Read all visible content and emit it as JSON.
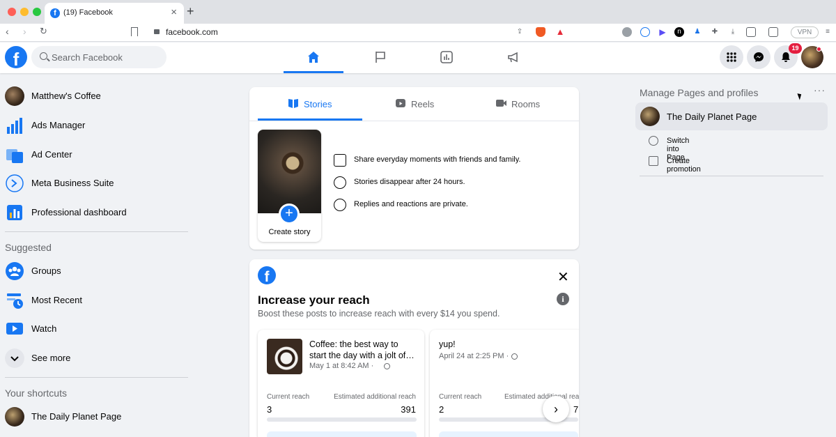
{
  "browser": {
    "tab_title": "(19) Facebook",
    "tab_close": "×",
    "new_tab": "+",
    "url": "facebook.com",
    "vpn_label": "VPN"
  },
  "header": {
    "logo": "f",
    "search_placeholder": "Search Facebook",
    "notifications_count": "19",
    "accent_color": "#1877f2",
    "nav_tabs": [
      "home-icon",
      "flag-icon",
      "chart-icon",
      "megaphone-icon"
    ]
  },
  "sidebar": {
    "items": [
      {
        "label": "Matthew's Coffee"
      },
      {
        "label": "Ads Manager"
      },
      {
        "label": "Ad Center"
      },
      {
        "label": "Meta Business Suite"
      },
      {
        "label": "Professional dashboard"
      }
    ],
    "suggested_heading": "Suggested",
    "suggested": [
      {
        "label": "Groups"
      },
      {
        "label": "Most Recent"
      },
      {
        "label": "Watch"
      },
      {
        "label": "See more"
      }
    ],
    "shortcuts_heading": "Your shortcuts",
    "shortcuts": [
      {
        "label": "The Daily Planet Page"
      }
    ]
  },
  "stories": {
    "tabs": [
      "Stories",
      "Reels",
      "Rooms"
    ],
    "create_label": "Create story",
    "info": [
      "Share everyday moments with friends and family.",
      "Stories disappear after 24 hours.",
      "Replies and reactions are private."
    ]
  },
  "reach": {
    "title": "Increase your reach",
    "subtitle": "Boost these posts to increase reach with every $14 you spend.",
    "info_glyph": "i",
    "close_glyph": "✕",
    "next_glyph": "›",
    "posts": [
      {
        "text": "Coffee: the best way to start the day with a jolt of…",
        "date": "May 1 at 8:42 AM ·",
        "current_label": "Current reach",
        "current_value": "3",
        "estimated_label": "Estimated additional reach",
        "estimated_value": "391"
      },
      {
        "text": "yup!",
        "date": "April 24 at 2:25 PM ·",
        "current_label": "Current reach",
        "current_value": "2",
        "estimated_label": "Estimated additional reach",
        "estimated_value": "7"
      }
    ]
  },
  "right": {
    "heading": "Manage Pages and profiles",
    "more": "···",
    "page_name": "The Daily Planet Page",
    "actions": [
      "Switch into Page",
      "Create promotion"
    ]
  }
}
